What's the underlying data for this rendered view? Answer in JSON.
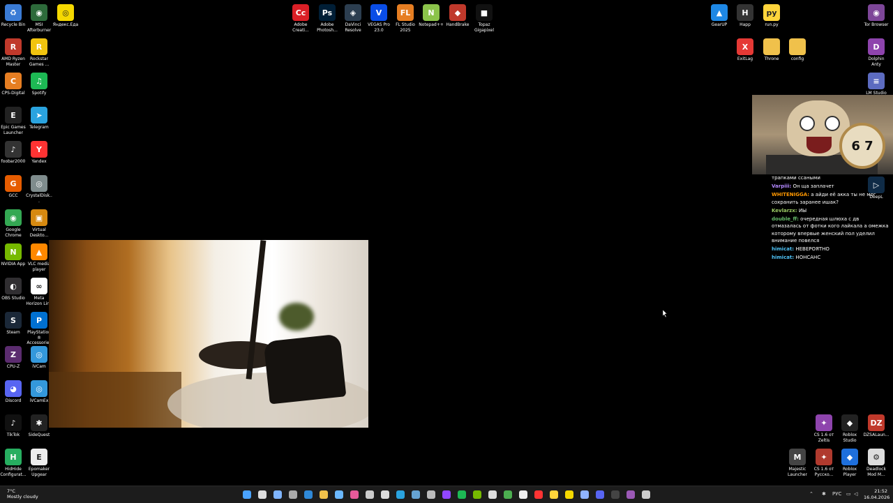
{
  "desktop_icons_left": [
    {
      "label": "Recycle Bin",
      "icon": "recycle-bin-icon",
      "color": "#3a7bd5",
      "glyph": "♻"
    },
    {
      "label": "MSI Afterburner",
      "icon": "msi-afterburner-icon",
      "color": "#2d6a3a",
      "glyph": "◉"
    },
    {
      "label": "AMD Ryzen Master",
      "icon": "amd-ryzen-icon",
      "color": "#c0392b",
      "glyph": "R"
    },
    {
      "label": "Rockstar Games ...",
      "icon": "rockstar-icon",
      "color": "#f1c40f",
      "glyph": "R"
    },
    {
      "label": "CPS-Digital",
      "icon": "cps-digital-icon",
      "color": "#e67e22",
      "glyph": "C"
    },
    {
      "label": "Spotify",
      "icon": "spotify-icon",
      "color": "#1db954",
      "glyph": "♫"
    },
    {
      "label": "Epic Games Launcher",
      "icon": "epic-games-icon",
      "color": "#222222",
      "glyph": "E"
    },
    {
      "label": "Telegram",
      "icon": "telegram-icon",
      "color": "#2aa3df",
      "glyph": "➤"
    },
    {
      "label": "foobar2000",
      "icon": "foobar-icon",
      "color": "#333333",
      "glyph": "♪"
    },
    {
      "label": "Yandex",
      "icon": "yandex-icon",
      "color": "#ff3333",
      "glyph": "Y"
    },
    {
      "label": "GCC",
      "icon": "gcc-icon",
      "color": "#e65c00",
      "glyph": "G"
    },
    {
      "label": "CrystalDisk...",
      "icon": "crystaldisk-icon",
      "color": "#7f8c8d",
      "glyph": "◎"
    },
    {
      "label": "Google Chrome",
      "icon": "chrome-icon",
      "color": "#34a853",
      "glyph": "◉"
    },
    {
      "label": "Virtual Deskto...",
      "icon": "virtual-desktop-icon",
      "color": "#d68910",
      "glyph": "▣"
    },
    {
      "label": "NVIDIA App",
      "icon": "nvidia-icon",
      "color": "#76b900",
      "glyph": "N"
    },
    {
      "label": "VLC media player",
      "icon": "vlc-icon",
      "color": "#ff8800",
      "glyph": "▲"
    },
    {
      "label": "OBS Studio",
      "icon": "obs-icon",
      "color": "#302e31",
      "glyph": "◐"
    },
    {
      "label": "Meta Horizon Link",
      "icon": "meta-icon",
      "color": "#ffffff",
      "glyph": "∞"
    },
    {
      "label": "Steam",
      "icon": "steam-icon",
      "color": "#1b2838",
      "glyph": "S"
    },
    {
      "label": "PlayStation® Accessories",
      "icon": "playstation-icon",
      "color": "#0070d1",
      "glyph": "P"
    },
    {
      "label": "CPU-Z",
      "icon": "cpuz-icon",
      "color": "#5b2c6f",
      "glyph": "Z"
    },
    {
      "label": "iVCam",
      "icon": "ivcam-icon",
      "color": "#3498db",
      "glyph": "◎"
    },
    {
      "label": "Discord",
      "icon": "discord-icon",
      "color": "#5865f2",
      "glyph": "◕"
    },
    {
      "label": "iVCamEx",
      "icon": "ivcamex-icon",
      "color": "#3498db",
      "glyph": "◎"
    },
    {
      "label": "TikTok",
      "icon": "tiktok-icon",
      "color": "#111111",
      "glyph": "♪"
    },
    {
      "label": "SideQuest",
      "icon": "sidequest-icon",
      "color": "#222222",
      "glyph": "✱"
    },
    {
      "label": "HidHide Configurat...",
      "icon": "hidhide-icon",
      "color": "#27ae60",
      "glyph": "H"
    },
    {
      "label": "Epomaker Upgear",
      "icon": "epomaker-icon",
      "color": "#eeeeee",
      "glyph": "E"
    }
  ],
  "desktop_icons_top": [
    {
      "label": "Яндекс.Еда",
      "icon": "yandex-eda-icon",
      "color": "#f5d800",
      "glyph": "◎"
    },
    {
      "label": "Adobe Creati...",
      "icon": "adobe-cc-icon",
      "color": "#da1f26",
      "glyph": "Cc"
    },
    {
      "label": "Adobe Photosh...",
      "icon": "photoshop-icon",
      "color": "#001e36",
      "glyph": "Ps"
    },
    {
      "label": "DaVinci Resolve",
      "icon": "davinci-icon",
      "color": "#2c3e50",
      "glyph": "◈"
    },
    {
      "label": "VEGAS Pro 23.0",
      "icon": "vegas-icon",
      "color": "#0a4de6",
      "glyph": "V"
    },
    {
      "label": "FL Studio 2025",
      "icon": "fl-studio-icon",
      "color": "#e67e22",
      "glyph": "FL"
    },
    {
      "label": "Notepad++",
      "icon": "notepadpp-icon",
      "color": "#8bc34a",
      "glyph": "N"
    },
    {
      "label": "HandBrake",
      "icon": "handbrake-icon",
      "color": "#c0392b",
      "glyph": "◆"
    },
    {
      "label": "Topaz Gigapixel",
      "icon": "topaz-icon",
      "color": "#111111",
      "glyph": "■"
    }
  ],
  "desktop_icons_right": [
    {
      "label": "GearUP",
      "icon": "gearup-icon",
      "color": "#1e88e5",
      "glyph": "▲"
    },
    {
      "label": "Happ",
      "icon": "happ-icon",
      "color": "#333333",
      "glyph": "H"
    },
    {
      "label": "run.py",
      "icon": "python-file-icon",
      "color": "#ffd43b",
      "glyph": "py"
    },
    {
      "label": "Tor Browser",
      "icon": "tor-icon",
      "color": "#7d4698",
      "glyph": "◉"
    },
    {
      "label": "ExitLag",
      "icon": "exitlag-icon",
      "color": "#e53935",
      "glyph": "X"
    },
    {
      "label": "Throne",
      "icon": "folder-icon",
      "color": "#f0c14b",
      "glyph": ""
    },
    {
      "label": "config",
      "icon": "folder-icon",
      "color": "#f0c14b",
      "glyph": ""
    },
    {
      "label": "Dolphin Anty",
      "icon": "dolphin-anty-icon",
      "color": "#8e44ad",
      "glyph": "D"
    },
    {
      "label": "LM Studio",
      "icon": "lm-studio-icon",
      "color": "#5c6bc0",
      "glyph": "≡"
    },
    {
      "label": "DeepL",
      "icon": "deepl-icon",
      "color": "#0f2b46",
      "glyph": "▷"
    }
  ],
  "desktop_icons_bottom_right": [
    {
      "label": "CS 1.6 от Zeltis",
      "icon": "cs16-icon",
      "color": "#8e44ad",
      "glyph": "✦"
    },
    {
      "label": "Roblox Studio",
      "icon": "roblox-studio-icon",
      "color": "#222222",
      "glyph": "◆"
    },
    {
      "label": "DZSALaun...",
      "icon": "dzsa-icon",
      "color": "#c0392b",
      "glyph": "DZ"
    },
    {
      "label": "Majestic Launcher",
      "icon": "majestic-icon",
      "color": "#444444",
      "glyph": "M"
    },
    {
      "label": "CS 1.6 от Русско...",
      "icon": "cs16-ru-icon",
      "color": "#b03a2e",
      "glyph": "✦"
    },
    {
      "label": "Roblox Player",
      "icon": "roblox-player-icon",
      "color": "#1e6fdc",
      "glyph": "◆"
    },
    {
      "label": "Deadlock Mod M...",
      "icon": "deadlock-icon",
      "color": "#dddddd",
      "glyph": "⚙"
    }
  ],
  "chat": [
    {
      "user": "",
      "user_color": "#ffffff",
      "text": "трапками ссаными"
    },
    {
      "user": "Varpiii:",
      "user_color": "#b388ff",
      "text": "Он ща заплачет"
    },
    {
      "user": "WHITENIGGA:",
      "user_color": "#ff9800",
      "text": "а айди её акка ты не мог сохранить заранее ишак?"
    },
    {
      "user": "Kevlarzx:",
      "user_color": "#9ccc65",
      "text": "ИЫ"
    },
    {
      "user": "double_ff:",
      "user_color": "#66bb6a",
      "text": "очередная шлюха с дв отмазалась от фотки кого лайкала а омежка которому впервые женский пол уделил внимание повелся"
    },
    {
      "user": "himicat:",
      "user_color": "#4fc3f7",
      "text": "НЕВЕРОЯТНО"
    },
    {
      "user": "himicat:",
      "user_color": "#4fc3f7",
      "text": "НОНСАНС"
    }
  ],
  "cat_image": {
    "watch_text": "6 7"
  },
  "taskbar": {
    "weather_temp": "7°C",
    "weather_desc": "Mostly cloudy",
    "language": "РУС",
    "time": "21:52",
    "date": "16.04.2026",
    "apps": [
      {
        "icon": "windows-start-icon",
        "color": "#4aa3ff"
      },
      {
        "icon": "search-icon",
        "color": "#dddddd"
      },
      {
        "icon": "task-view-icon",
        "color": "#7fb5ff"
      },
      {
        "icon": "copilot-icon",
        "color": "#aaaaaa"
      },
      {
        "icon": "vscode-icon",
        "color": "#2f89d7"
      },
      {
        "icon": "file-explorer-icon",
        "color": "#f0c14b"
      },
      {
        "icon": "terminal-icon",
        "color": "#6bb8ff"
      },
      {
        "icon": "app-icon",
        "color": "#e85a9b"
      },
      {
        "icon": "calculator-icon",
        "color": "#cccccc"
      },
      {
        "icon": "calendar-icon",
        "color": "#dddddd"
      },
      {
        "icon": "telegram-icon",
        "color": "#2aa3df"
      },
      {
        "icon": "steam-icon",
        "color": "#66a3d2"
      },
      {
        "icon": "settings-icon",
        "color": "#bbbbbb"
      },
      {
        "icon": "twitch-icon",
        "color": "#9146ff"
      },
      {
        "icon": "spotify-icon",
        "color": "#1db954"
      },
      {
        "icon": "nvidia-icon",
        "color": "#76b900"
      },
      {
        "icon": "app-icon",
        "color": "#dddddd"
      },
      {
        "icon": "chrome-icon",
        "color": "#4caf50"
      },
      {
        "icon": "obs-icon",
        "color": "#eeeeee"
      },
      {
        "icon": "yandex-icon",
        "color": "#ff3333"
      },
      {
        "icon": "python-icon",
        "color": "#ffd43b"
      },
      {
        "icon": "yandex-eda-icon",
        "color": "#f5d800"
      },
      {
        "icon": "app-icon",
        "color": "#8fb3ff"
      },
      {
        "icon": "discord-icon",
        "color": "#5865f2"
      },
      {
        "icon": "app-icon",
        "color": "#444444"
      },
      {
        "icon": "tor-icon",
        "color": "#9b59b6"
      },
      {
        "icon": "app-icon",
        "color": "#cccccc"
      }
    ]
  }
}
